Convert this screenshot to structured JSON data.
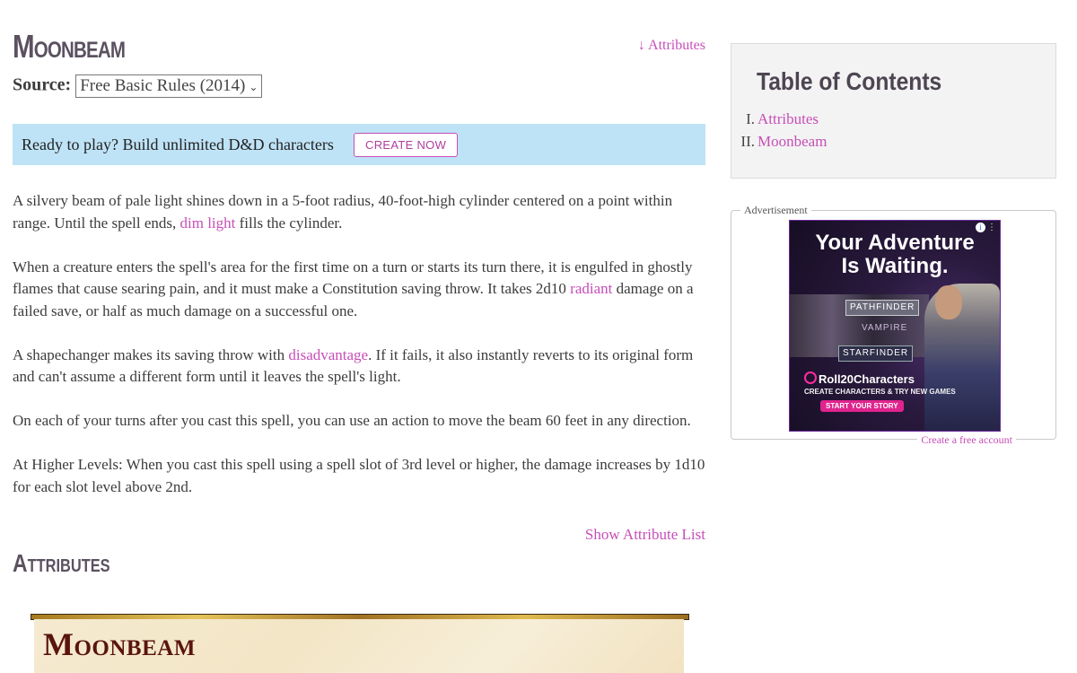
{
  "page": {
    "title": "Moonbeam",
    "attributes_link": "↓ Attributes",
    "source_label": "Source:",
    "source_value": "Free Basic Rules (2014)"
  },
  "promo": {
    "text": "Ready to play? Build unlimited D&D characters",
    "button": "CREATE NOW",
    "bg_color": "#bfe3f6"
  },
  "description": {
    "p1": {
      "before": "A silvery beam of pale light shines down in a 5-foot radius, 40-foot-high cylinder centered on a point within range. Until the spell ends, ",
      "link": "dim light",
      "after": " fills the cylinder."
    },
    "p2": {
      "before": "When a creature enters the spell's area for the first time on a turn or starts its turn there, it is engulfed in ghostly flames that cause searing pain, and it must make a Constitution saving throw. It takes 2d10 ",
      "link": "radiant",
      "after": " damage on a failed save, or half as much damage on a successful one."
    },
    "p3": {
      "before": "A shapechanger makes its saving throw with ",
      "link": "disadvantage",
      "after": ". If it fails, it also instantly reverts to its original form and can't assume a different form until it leaves the spell's light."
    },
    "p4": "On each of your turns after you cast this spell, you can use an action to move the beam 60 feet in any direction.",
    "p5": "At Higher Levels: When you cast this spell using a spell slot of 3rd level or higher, the damage increases by 1d10 for each slot level above 2nd."
  },
  "show_attribute_list": "Show Attribute List",
  "attributes_heading": "Attributes",
  "card": {
    "title": "Moonbeam"
  },
  "toc": {
    "title": "Table of Contents",
    "items": [
      {
        "num": "I.",
        "label": "Attributes"
      },
      {
        "num": "II.",
        "label": "Moonbeam"
      }
    ]
  },
  "ad": {
    "label": "Advertisement",
    "footer_link": "Create a free account",
    "headline_1": "Your Adventure",
    "headline_2": "Is Waiting.",
    "tile_1": "PATHFINDER",
    "tile_2": "VAMPIRE",
    "tile_3": "STARFINDER",
    "brand": "Roll20Characters",
    "tagline": "CREATE CHARACTERS & TRY NEW GAMES",
    "cta": "START YOUR STORY",
    "info_icon": "info-icon"
  },
  "colors": {
    "link": "#c74eb7",
    "heading": "#5b5160",
    "card_title": "#5a1410"
  }
}
